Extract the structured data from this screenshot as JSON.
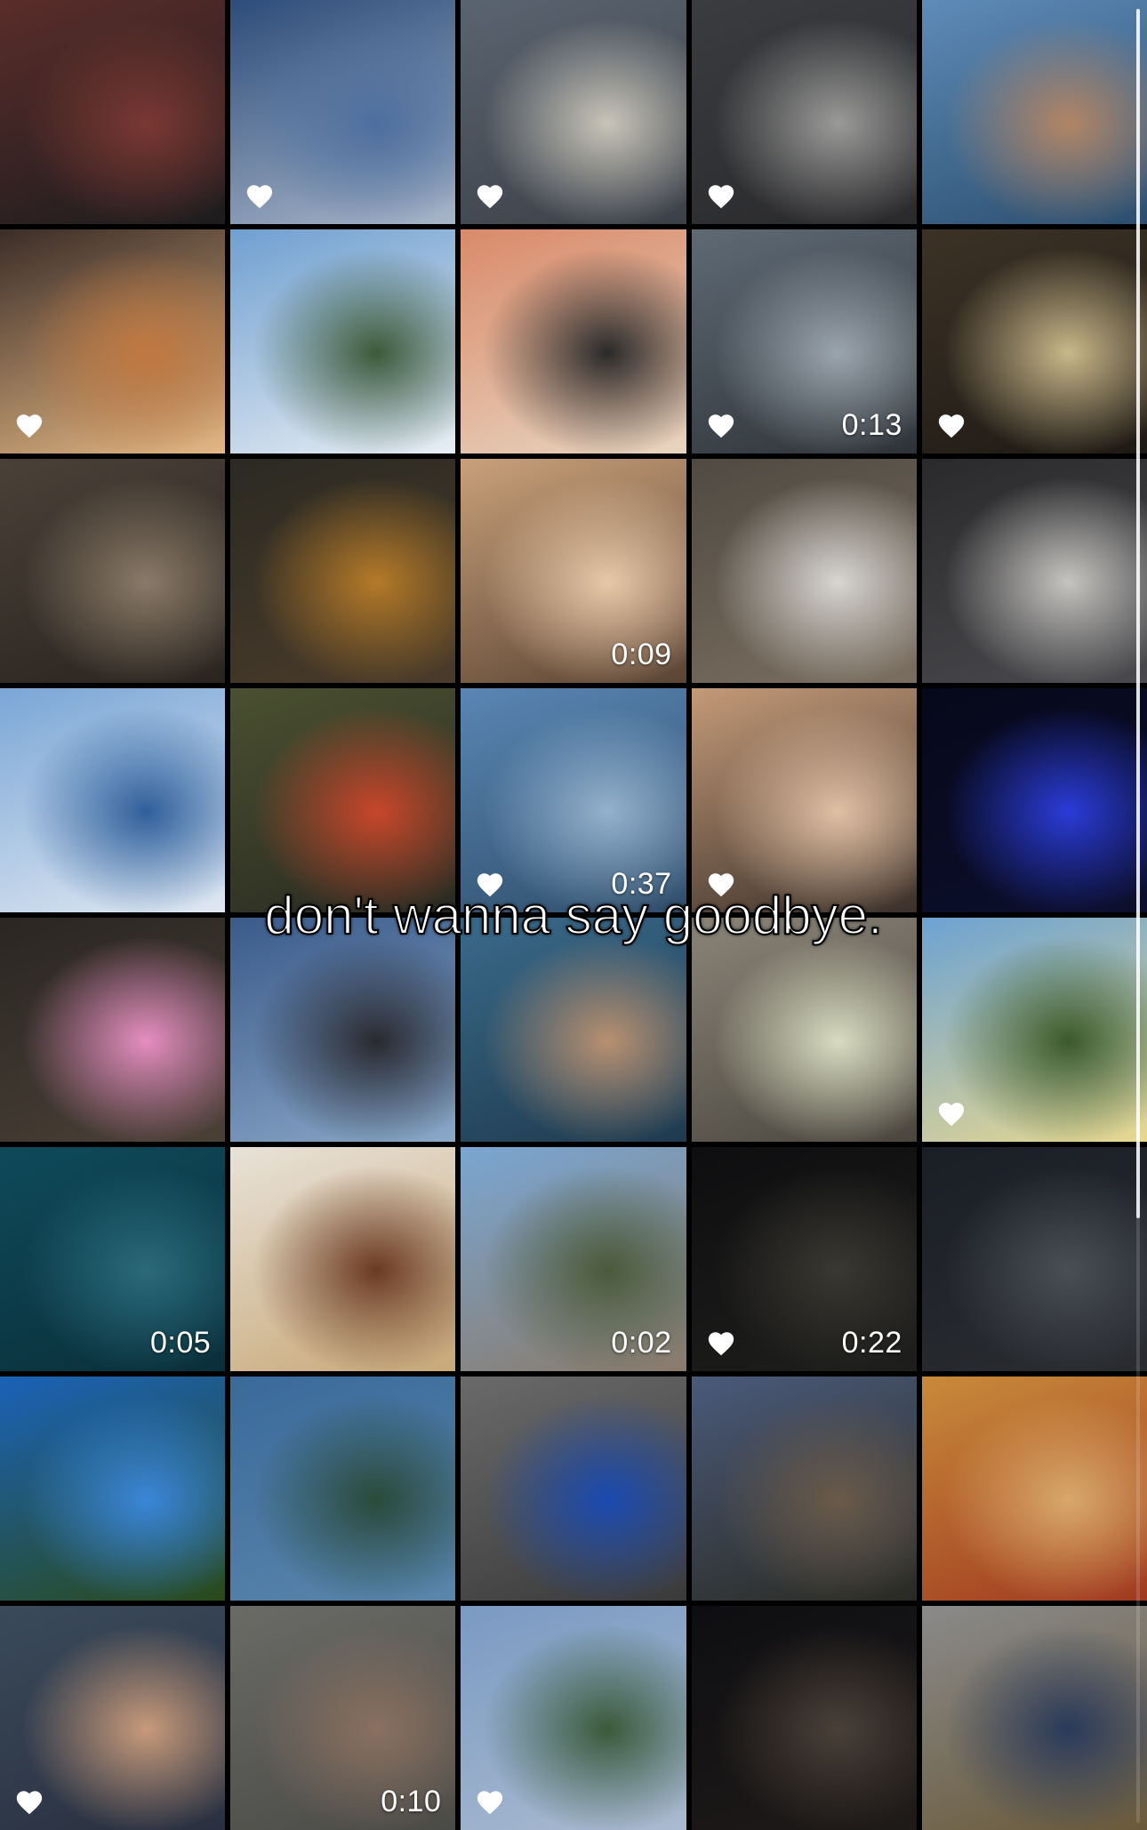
{
  "caption": "don't wanna say goodbye.",
  "tiles": [
    {
      "name": "tile-passports",
      "heart": false,
      "duration": "",
      "colors": [
        "#5a2d2a",
        "#7a3833",
        "#1d1c1e"
      ]
    },
    {
      "name": "tile-plane-wing-sky",
      "heart": true,
      "duration": "",
      "colors": [
        "#2c4c7a",
        "#4d6f9f",
        "#a9b6c9"
      ]
    },
    {
      "name": "tile-beach-umbrellas",
      "heart": true,
      "duration": "",
      "colors": [
        "#5a6470",
        "#c8c4b8",
        "#3c4048"
      ]
    },
    {
      "name": "tile-sunbeds",
      "heart": true,
      "duration": "",
      "colors": [
        "#3a3c40",
        "#9a9a98",
        "#2a2a2c"
      ]
    },
    {
      "name": "tile-boat-man",
      "heart": false,
      "duration": "",
      "colors": [
        "#5e8bb8",
        "#b28565",
        "#2b4e6e"
      ]
    },
    {
      "name": "tile-cocktails",
      "heart": true,
      "duration": "",
      "colors": [
        "#3b2d28",
        "#c07840",
        "#e5b884"
      ]
    },
    {
      "name": "tile-yacht-coast",
      "heart": false,
      "duration": "",
      "colors": [
        "#6f9fd0",
        "#3d5a3a",
        "#e8eef4"
      ]
    },
    {
      "name": "tile-food-table",
      "heart": false,
      "duration": "",
      "colors": [
        "#d98a6a",
        "#2a2a2a",
        "#e8d5c0"
      ]
    },
    {
      "name": "tile-beach-walk",
      "heart": true,
      "duration": "0:13",
      "colors": [
        "#5f6a75",
        "#9ba5ad",
        "#2e3338"
      ]
    },
    {
      "name": "tile-oysters",
      "heart": true,
      "duration": "",
      "colors": [
        "#3c3226",
        "#c9b88a",
        "#1f1a15"
      ]
    },
    {
      "name": "tile-hotel-lobby",
      "heart": false,
      "duration": "",
      "colors": [
        "#4a4138",
        "#8a7a68",
        "#2a241f"
      ]
    },
    {
      "name": "tile-dessert-bowl",
      "heart": false,
      "duration": "",
      "colors": [
        "#2b2a23",
        "#b57a28",
        "#4a3b2a"
      ]
    },
    {
      "name": "tile-selfie-blonde",
      "heart": false,
      "duration": "0:09",
      "colors": [
        "#c9a07a",
        "#e8c8a8",
        "#5a4434"
      ]
    },
    {
      "name": "tile-beach-chair",
      "heart": false,
      "duration": "",
      "colors": [
        "#504a42",
        "#d8d6d2",
        "#7a6e60"
      ]
    },
    {
      "name": "tile-menu-table",
      "heart": false,
      "duration": "",
      "colors": [
        "#2a2a2c",
        "#c6c4c0",
        "#4a4a4e"
      ]
    },
    {
      "name": "tile-sailboat-flag",
      "heart": false,
      "duration": "",
      "colors": [
        "#7aa6d6",
        "#2f5f9a",
        "#e0e8f2"
      ]
    },
    {
      "name": "tile-grilled-veg",
      "heart": false,
      "duration": "",
      "colors": [
        "#4a5030",
        "#c8462a",
        "#2a2a22"
      ]
    },
    {
      "name": "tile-boat-rail",
      "heart": true,
      "duration": "0:37",
      "colors": [
        "#5a86b4",
        "#93b1cc",
        "#2f4e6a"
      ]
    },
    {
      "name": "tile-portrait",
      "heart": true,
      "duration": "",
      "colors": [
        "#c49a78",
        "#e0c0a4",
        "#3a302a"
      ]
    },
    {
      "name": "tile-ferris-wheel",
      "heart": false,
      "duration": "",
      "colors": [
        "#06081a",
        "#2a3cd8",
        "#0c0f2c"
      ]
    },
    {
      "name": "tile-cotton-candy",
      "heart": false,
      "duration": "",
      "colors": [
        "#2a2622",
        "#e58ec0",
        "#4a4036"
      ]
    },
    {
      "name": "tile-phone-plane",
      "heart": false,
      "duration": "",
      "colors": [
        "#3a5a8a",
        "#2a2a30",
        "#8aa8c8"
      ]
    },
    {
      "name": "tile-boat-sea",
      "heart": false,
      "duration": "",
      "colors": [
        "#3a6a8a",
        "#b89070",
        "#1e3a4e"
      ]
    },
    {
      "name": "tile-drinks-tap",
      "heart": false,
      "duration": "",
      "colors": [
        "#8a8478",
        "#d8dcc0",
        "#4a463e"
      ]
    },
    {
      "name": "tile-couple-house",
      "heart": true,
      "duration": "",
      "colors": [
        "#6ca2d2",
        "#3a5a2a",
        "#e8d890"
      ]
    },
    {
      "name": "tile-swimming",
      "heart": false,
      "duration": "0:05",
      "colors": [
        "#0f4a5a",
        "#2a6a7a",
        "#0a2f3a"
      ]
    },
    {
      "name": "tile-plate-dessert",
      "heart": false,
      "duration": "",
      "colors": [
        "#e8e2d8",
        "#6a3a22",
        "#c8a878"
      ]
    },
    {
      "name": "tile-street-pines",
      "heart": false,
      "duration": "0:02",
      "colors": [
        "#7aa6d2",
        "#4a5a3a",
        "#8a7a6a"
      ]
    },
    {
      "name": "tile-night-beach",
      "heart": true,
      "duration": "0:22",
      "colors": [
        "#0e0e10",
        "#3a3832",
        "#1e1e1c"
      ]
    },
    {
      "name": "tile-beach-night-umbrella",
      "heart": false,
      "duration": "",
      "colors": [
        "#1a1e26",
        "#4a4e56",
        "#2a2c30"
      ]
    },
    {
      "name": "tile-palm-tree",
      "heart": false,
      "duration": "",
      "colors": [
        "#1a62b8",
        "#3a86d8",
        "#2a4a1a"
      ]
    },
    {
      "name": "tile-sea-cliffs",
      "heart": false,
      "duration": "",
      "colors": [
        "#3a6a9a",
        "#2a4a3a",
        "#5a86ac"
      ]
    },
    {
      "name": "tile-sunscreen",
      "heart": false,
      "duration": "",
      "colors": [
        "#6a6a6a",
        "#1a4ab0",
        "#3a3a3a"
      ]
    },
    {
      "name": "tile-castle",
      "heart": false,
      "duration": "",
      "colors": [
        "#4a5a7a",
        "#6a5a4a",
        "#2a2a22"
      ]
    },
    {
      "name": "tile-pizza",
      "heart": false,
      "duration": "",
      "colors": [
        "#c88a3a",
        "#d8a86a",
        "#a03a20"
      ]
    },
    {
      "name": "tile-group-selfie",
      "heart": true,
      "duration": "",
      "colors": [
        "#3a4a5a",
        "#c89a7a",
        "#2a3040"
      ]
    },
    {
      "name": "tile-bird-hand",
      "heart": false,
      "duration": "0:10",
      "colors": [
        "#6a6a66",
        "#8a7060",
        "#4a4a46"
      ]
    },
    {
      "name": "tile-mountains-plane",
      "heart": true,
      "duration": "",
      "colors": [
        "#7a9ac2",
        "#3a5a3a",
        "#aabad0"
      ]
    },
    {
      "name": "tile-hotel-night",
      "heart": false,
      "duration": "",
      "colors": [
        "#0e0e12",
        "#4a4038",
        "#1e1a18"
      ]
    },
    {
      "name": "tile-police",
      "heart": false,
      "duration": "",
      "colors": [
        "#8a8a8a",
        "#2a3a5a",
        "#6a5a3a"
      ]
    }
  ]
}
